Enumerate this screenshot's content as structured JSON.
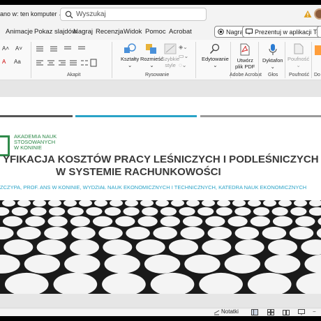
{
  "titlebar": {
    "saved_status": "ano w: ten komputer",
    "search_placeholder": "Wyszukaj"
  },
  "menu": {
    "tabs": [
      "Animacje",
      "Pokaz slajdów",
      "Nagraj",
      "Recenzja",
      "Widok",
      "Pomoc",
      "Acrobat"
    ],
    "record_label": "Nagraj",
    "teams_label": "Prezentuj w aplikacji Teams"
  },
  "ribbon": {
    "groups": {
      "paragraph": "Akapit",
      "drawing": "Rysowanie",
      "adobe": "Adobe Acrobat",
      "voice": "Głos",
      "sensitivity": "Poufność",
      "designer": "Do"
    },
    "buttons": {
      "shapes": "Kształty",
      "arrange": "Rozmieść",
      "quick_styles_1": "Szybkie",
      "quick_styles_2": "style",
      "editing": "Edytowanie",
      "create_pdf_1": "Utwórz",
      "create_pdf_2": "plik PDF",
      "dictate": "Dyktafon",
      "sensitivity": "Poufność"
    }
  },
  "slide": {
    "logo_lines": [
      "AKADEMIA NAUK",
      "STOSOWANYCH",
      "W KONINIE"
    ],
    "title_line1": "YFIKACJA KOSZTÓW PRACY LEŚNICZYCH I PODLEŚNICZYCH",
    "title_line2": "W SYSTEMIE RACHUNKOWOŚCI",
    "authors": "ZCZYPA, PROF. ANS W KONINIE, WYDZIAŁ NAUK EKONOMICZNYCH I TECHNICZNYCH, KATEDRA NAUK EKONOMICZNYCH"
  },
  "statusbar": {
    "notes_label": "Notatki"
  },
  "colors": {
    "accent_green": "#2f8a4a",
    "accent_blue": "#2aa3c7",
    "title_gray": "#3a3a3a"
  }
}
